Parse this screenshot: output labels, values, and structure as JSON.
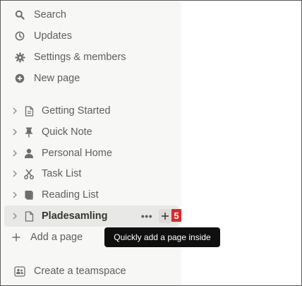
{
  "sidebar": {
    "top_items": [
      {
        "label": "Search",
        "icon": "search-icon"
      },
      {
        "label": "Updates",
        "icon": "clock-icon"
      },
      {
        "label": "Settings & members",
        "icon": "gear-icon"
      },
      {
        "label": "New page",
        "icon": "plus-circle-icon"
      }
    ],
    "pages": [
      {
        "label": "Getting Started",
        "icon": "document-icon"
      },
      {
        "label": "Quick Note",
        "icon": "pin-icon"
      },
      {
        "label": "Personal Home",
        "icon": "person-icon"
      },
      {
        "label": "Task List",
        "icon": "scissors-icon"
      },
      {
        "label": "Reading List",
        "icon": "book-icon"
      },
      {
        "label": "Pladesamling",
        "icon": "document-icon"
      }
    ],
    "more_label": "•••",
    "badge_number": "5",
    "add_page_label": "Add a page",
    "create_teamspace_label": "Create a teamspace"
  },
  "tooltip": {
    "text": "Quickly add a page inside"
  },
  "colors": {
    "sidebar_bg": "#f7f7f5",
    "active_row_bg": "#e8e8e6",
    "badge_red": "#d52b2b",
    "tooltip_bg": "#0f0f0f"
  }
}
